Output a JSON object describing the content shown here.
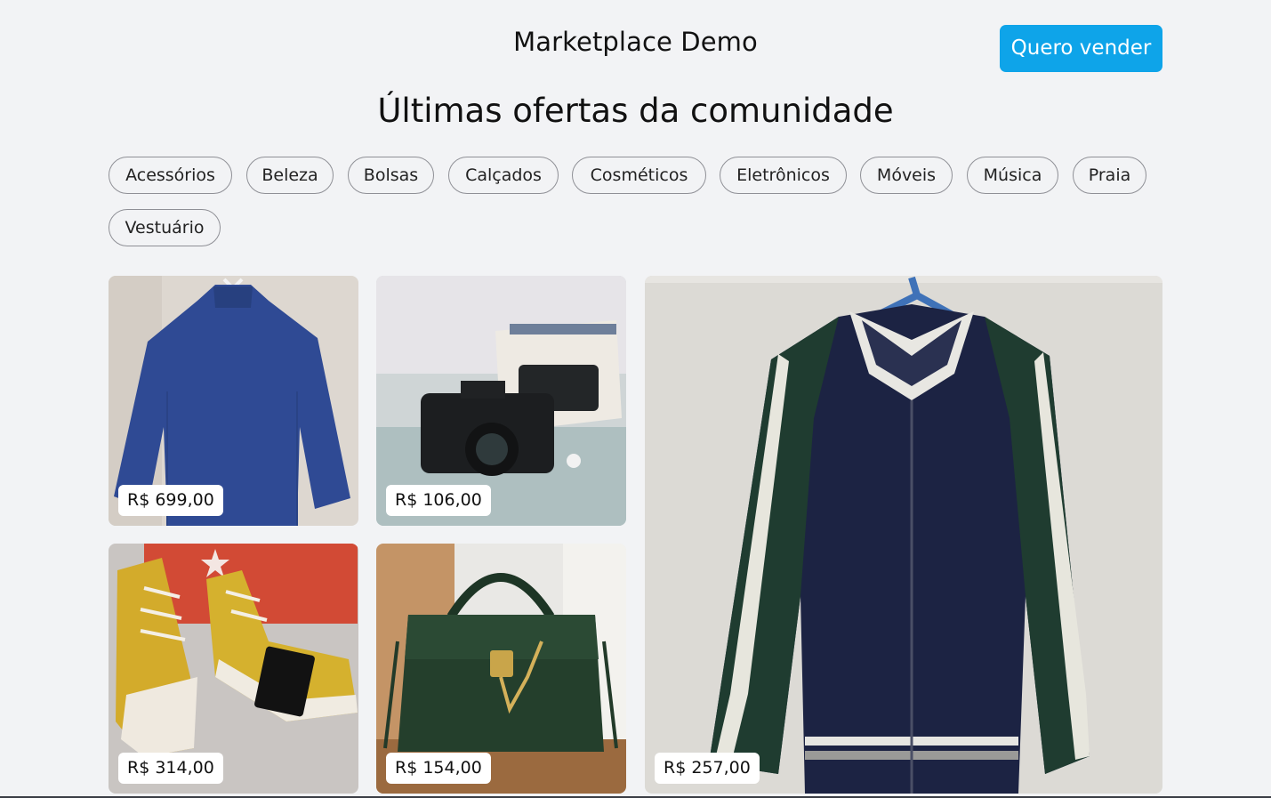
{
  "header": {
    "brand": "Marketplace Demo",
    "sell_button": "Quero vender"
  },
  "main": {
    "title": "Últimas ofertas da comunidade"
  },
  "categories": [
    "Acessórios",
    "Beleza",
    "Bolsas",
    "Calçados",
    "Cosméticos",
    "Eletrônicos",
    "Móveis",
    "Música",
    "Praia",
    "Vestuário"
  ],
  "products": [
    {
      "price": "R$ 699,00",
      "image": "blue-sweater"
    },
    {
      "price": "R$ 106,00",
      "image": "film-camera"
    },
    {
      "price": "R$ 257,00",
      "image": "bomber-jacket"
    },
    {
      "price": "R$ 314,00",
      "image": "yellow-sneakers"
    },
    {
      "price": "R$ 154,00",
      "image": "green-handbag"
    }
  ],
  "colors": {
    "accent": "#0ea4e9",
    "background": "#f2f3f5"
  }
}
